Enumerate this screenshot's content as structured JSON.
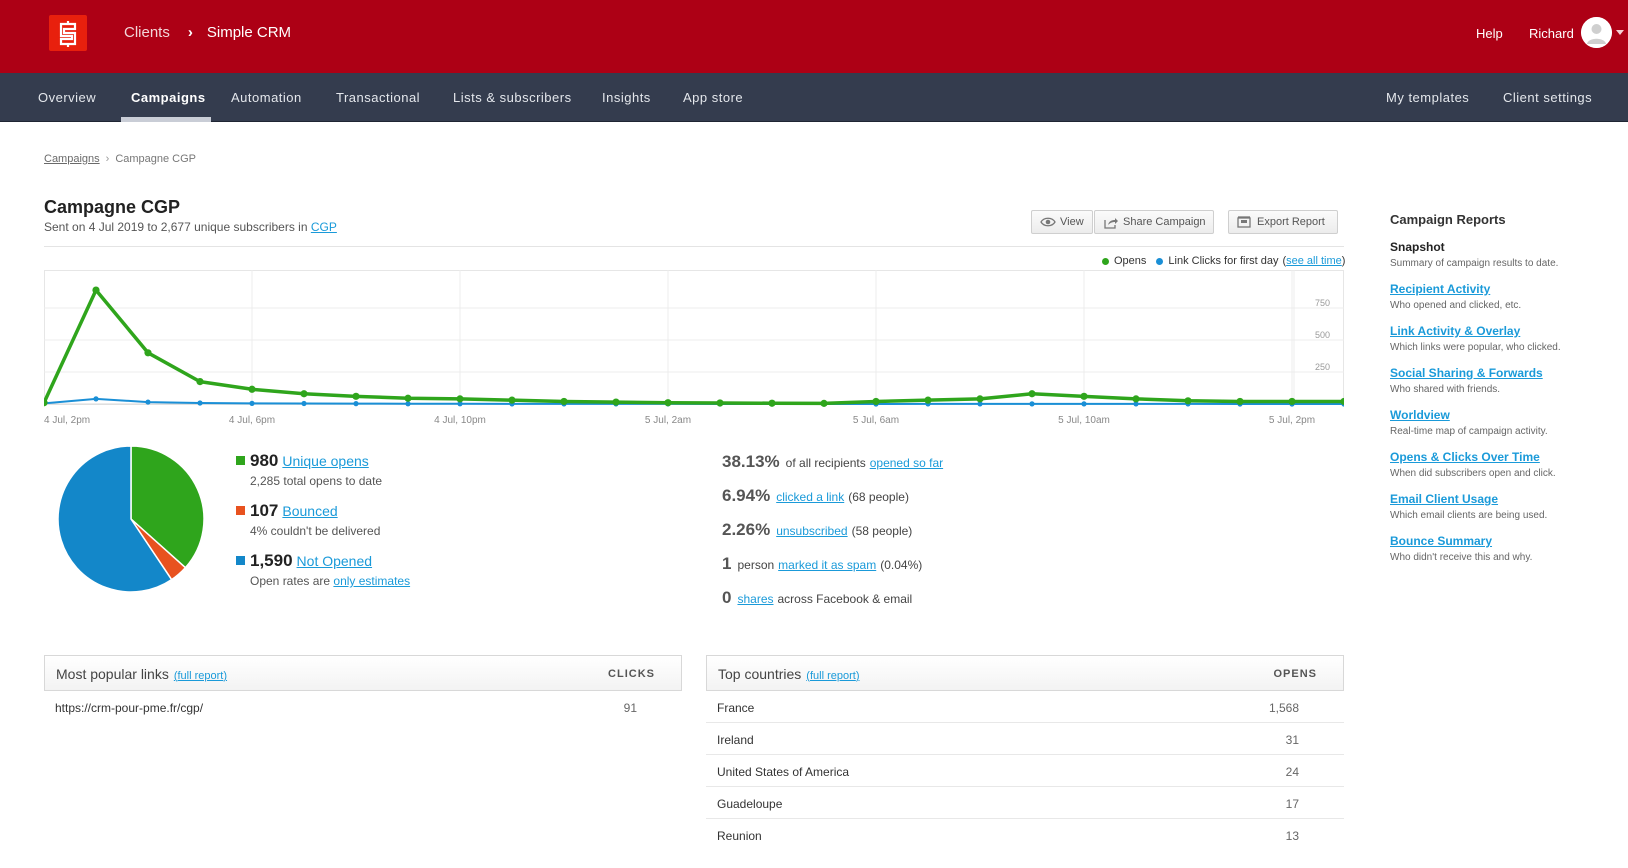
{
  "topbar": {
    "breadcrumb_parent": "Clients",
    "breadcrumb_separator": "›",
    "app_name": "Simple CRM",
    "help": "Help",
    "user_name": "Richard"
  },
  "nav": {
    "items": [
      "Overview",
      "Campaigns",
      "Automation",
      "Transactional",
      "Lists & subscribers",
      "Insights",
      "App store"
    ],
    "active": "Campaigns",
    "right_items": [
      "My templates",
      "Client settings"
    ]
  },
  "breadcrumb": {
    "parent": "Campaigns",
    "current": "Campagne CGP"
  },
  "campaign": {
    "title": "Campagne CGP",
    "sent_prefix": "Sent on 4 Jul 2019 to 2,677 unique subscribers in",
    "list_link": "CGP"
  },
  "buttons": {
    "view": "View",
    "share": "Share Campaign",
    "export": "Export Report"
  },
  "legend": {
    "opens": "Opens",
    "clicks": "Link Clicks for first day",
    "see_all": "see all time"
  },
  "colors": {
    "brand": "#ad0015",
    "nav": "#343c4e",
    "opens": "#2fa51c",
    "clicks": "#1a8fd6",
    "bounced": "#e8521f",
    "not_opened": "#1387c9",
    "link": "#1a9ad9"
  },
  "chart_data": {
    "type": "line",
    "x": [
      "4 Jul, 2pm",
      "4 Jul, 3pm",
      "4 Jul, 4pm",
      "4 Jul, 5pm",
      "4 Jul, 6pm",
      "4 Jul, 7pm",
      "4 Jul, 8pm",
      "4 Jul, 9pm",
      "4 Jul, 10pm",
      "4 Jul, 11pm",
      "5 Jul, 12am",
      "5 Jul, 1am",
      "5 Jul, 2am",
      "5 Jul, 3am",
      "5 Jul, 4am",
      "5 Jul, 5am",
      "5 Jul, 6am",
      "5 Jul, 7am",
      "5 Jul, 8am",
      "5 Jul, 9am",
      "5 Jul, 10am",
      "5 Jul, 11am",
      "5 Jul, 12pm",
      "5 Jul, 1pm",
      "5 Jul, 2pm",
      "5 Jul, 3pm"
    ],
    "tick_labels": [
      "4 Jul, 2pm",
      "4 Jul, 6pm",
      "4 Jul, 10pm",
      "5 Jul, 2am",
      "5 Jul, 6am",
      "5 Jul, 10am",
      "5 Jul, 2pm"
    ],
    "series": [
      {
        "name": "Opens",
        "values": [
          10,
          890,
          400,
          175,
          115,
          80,
          60,
          45,
          40,
          30,
          20,
          15,
          10,
          8,
          6,
          5,
          20,
          30,
          40,
          80,
          60,
          40,
          25,
          20,
          20,
          20
        ]
      },
      {
        "name": "Link Clicks for first day",
        "values": [
          5,
          40,
          15,
          8,
          5,
          4,
          3,
          2,
          2,
          1,
          1,
          1,
          1,
          0,
          0,
          0,
          0,
          1,
          1,
          1,
          1,
          1,
          1,
          0,
          0,
          0
        ]
      }
    ],
    "yticks": [
      250,
      500,
      750
    ],
    "ylim": [
      0,
      1000
    ],
    "grid": true,
    "legend": "top-right"
  },
  "pie_data": {
    "type": "pie",
    "slices": [
      {
        "name": "Unique opens",
        "value": 980
      },
      {
        "name": "Bounced",
        "value": 107
      },
      {
        "name": "Not Opened",
        "value": 1590
      }
    ]
  },
  "stats": {
    "opens": {
      "num": "980",
      "label": "Unique opens",
      "sub": "2,285 total opens to date"
    },
    "bounced": {
      "num": "107",
      "label": "Bounced",
      "sub": "4% couldn't be delivered"
    },
    "not_opened": {
      "num": "1,590",
      "label": "Not Opened",
      "sub_prefix": "Open rates are",
      "sub_link": "only estimates"
    }
  },
  "rates": [
    {
      "big": "38.13%",
      "pre": "of all recipients",
      "link": "opened so far",
      "post": ""
    },
    {
      "big": "6.94%",
      "pre": "",
      "link": "clicked a link",
      "post": "(68 people)"
    },
    {
      "big": "2.26%",
      "pre": "",
      "link": "unsubscribed",
      "post": "(58 people)"
    },
    {
      "big": "1",
      "pre": "person",
      "link": "marked it as spam",
      "post": "(0.04%)"
    },
    {
      "big": "0",
      "pre": "",
      "link": "shares",
      "post": "across Facebook & email"
    }
  ],
  "sidebar": {
    "title": "Campaign Reports",
    "items": [
      {
        "title": "Snapshot",
        "desc": "Summary of campaign results to date."
      },
      {
        "title": "Recipient Activity",
        "desc": "Who opened and clicked, etc."
      },
      {
        "title": "Link Activity & Overlay",
        "desc": "Which links were popular, who clicked."
      },
      {
        "title": "Social Sharing & Forwards",
        "desc": "Who shared with friends."
      },
      {
        "title": "Worldview",
        "desc": "Real-time map of campaign activity."
      },
      {
        "title": "Opens & Clicks Over Time",
        "desc": "When did subscribers open and click."
      },
      {
        "title": "Email Client Usage",
        "desc": "Which email clients are being used."
      },
      {
        "title": "Bounce Summary",
        "desc": "Who didn't receive this and why."
      }
    ]
  },
  "links_table": {
    "title": "Most popular links",
    "full_report": "full report",
    "col": "CLICKS",
    "rows": [
      {
        "k": "https://crm-pour-pme.fr/cgp/",
        "v": "91"
      }
    ]
  },
  "countries_table": {
    "title": "Top countries",
    "full_report": "full report",
    "col": "OPENS",
    "rows": [
      {
        "k": "France",
        "v": "1,568"
      },
      {
        "k": "Ireland",
        "v": "31"
      },
      {
        "k": "United States of America",
        "v": "24"
      },
      {
        "k": "Guadeloupe",
        "v": "17"
      },
      {
        "k": "Reunion",
        "v": "13"
      }
    ]
  }
}
